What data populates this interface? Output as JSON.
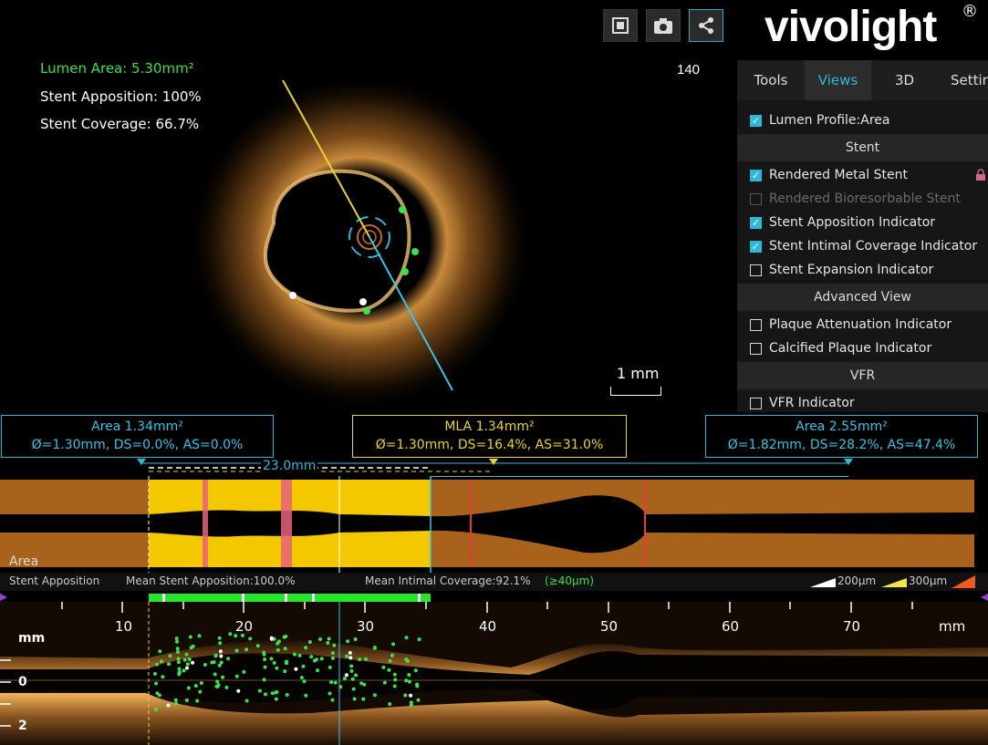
{
  "overlay": {
    "lumen_area": "Lumen Area: 5.30mm²",
    "stent_apposition": "Stent Apposition: 100%",
    "stent_coverage": "Stent Coverage: 66.7%",
    "frame_number": "140",
    "scale_label": "1 mm"
  },
  "toolbar": {
    "fullscreen_icon": "fullscreen-icon",
    "camera_icon": "camera-icon",
    "share_icon": "share-icon"
  },
  "brand": {
    "logo": "vivolight",
    "reg": "®"
  },
  "tabs": [
    {
      "label": "Tools"
    },
    {
      "label": "Views"
    },
    {
      "label": "3D"
    },
    {
      "label": "Setting"
    }
  ],
  "panel": {
    "lumen_profile": "Lumen Profile:Area",
    "section_stent": "Stent",
    "rendered_metal": "Rendered Metal Stent",
    "rendered_bioresorbable": "Rendered Bioresorbable Stent",
    "apposition_indicator": "Stent Apposition Indicator",
    "intimal_coverage": "Stent Intimal Coverage Indicator",
    "expansion_indicator": "Stent Expansion Indicator",
    "section_advanced": "Advanced View",
    "plaque_attenuation": "Plaque Attenuation Indicator",
    "calcified_plaque": "Calcified Plaque Indicator",
    "section_vfr": "VFR",
    "vfr_indicator": "VFR Indicator"
  },
  "boxes": {
    "left_title": "Area 1.34mm²",
    "left_detail": "Ø=1.30mm, DS=0.0%, AS=0.0%",
    "mid_title": "MLA 1.34mm²",
    "mid_detail": "Ø=1.30mm, DS=16.4%, AS=31.0%",
    "right_title": "Area 2.55mm²",
    "right_detail": "Ø=1.82mm, DS=28.2%, AS=47.4%",
    "length": "23.0mm"
  },
  "area_view": {
    "label": "Area"
  },
  "status": {
    "label": "Stent Apposition",
    "mean_apposition": "Mean Stent Apposition:100.0%",
    "mean_coverage": "Mean Intimal Coverage:92.1%",
    "coverage_threshold": "(≥40μm)",
    "legend_200": "200μm",
    "legend_300": "300μm"
  },
  "long_axis": {
    "ticks": [
      "10",
      "20",
      "30",
      "40",
      "50",
      "60",
      "70"
    ],
    "unit": "mm",
    "y_unit": "mm",
    "y_labels": [
      "0",
      "2"
    ]
  },
  "colors": {
    "accent": "#2fb7da",
    "lumen_green": "#3ee04a",
    "yellow": "#e8d233",
    "vessel_brown": "#a8621c",
    "stent_yellow": "#f3c800"
  }
}
